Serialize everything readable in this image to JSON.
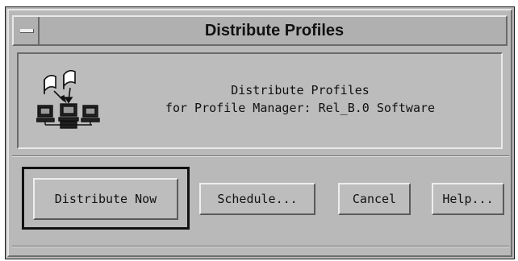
{
  "window": {
    "title": "Distribute Profiles"
  },
  "info": {
    "line1": "Distribute Profiles",
    "line2": "for Profile Manager: Rel_B.0 Software"
  },
  "icons": {
    "window_menu": "window-menu-icon",
    "network": "profile-distribution-network-icon"
  },
  "buttons": {
    "distribute_now": "Distribute Now",
    "schedule": "Schedule...",
    "cancel": "Cancel",
    "help": "Help..."
  }
}
